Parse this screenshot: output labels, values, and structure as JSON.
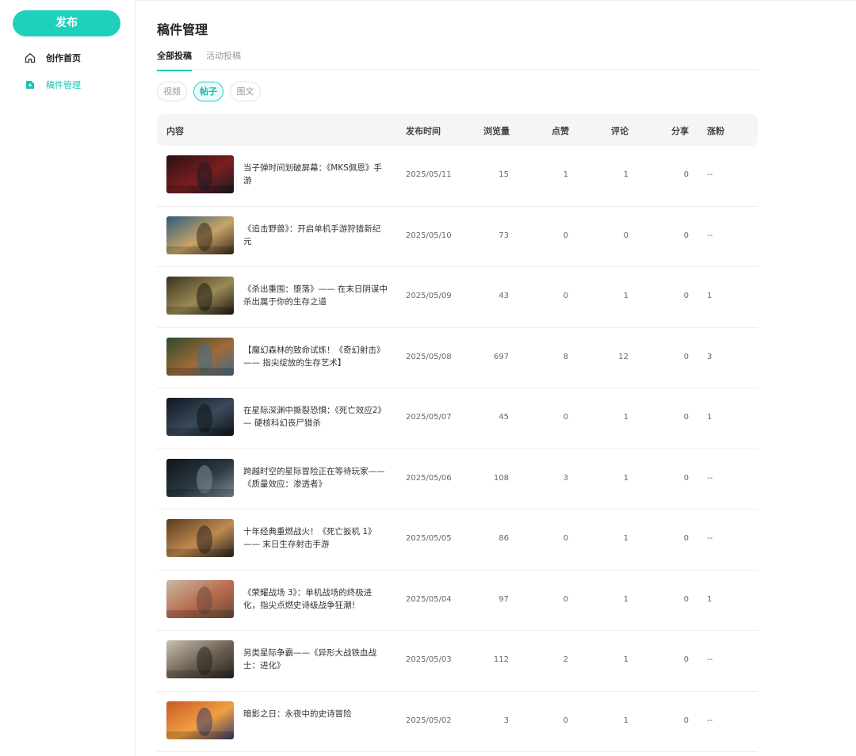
{
  "sidebar": {
    "publish_label": "发布",
    "items": [
      {
        "label": "创作首页",
        "icon": "home-icon"
      },
      {
        "label": "稿件管理",
        "icon": "document-icon",
        "active": true
      }
    ]
  },
  "main": {
    "title": "稿件管理",
    "tabs": [
      {
        "label": "全部投稿",
        "active": true
      },
      {
        "label": "活动投稿",
        "active": false
      }
    ],
    "chips": [
      {
        "label": "视频",
        "active": false
      },
      {
        "label": "帖子",
        "active": true
      },
      {
        "label": "图文",
        "active": false
      }
    ],
    "columns": {
      "content": "内容",
      "date": "发布时间",
      "views": "浏览量",
      "likes": "点赞",
      "comments": "评论",
      "shares": "分享",
      "fans": "涨粉"
    },
    "rows": [
      {
        "title": "当子弹时间划破屏幕：《MKS佩恩》手游",
        "date": "2025/05/11",
        "views": "15",
        "likes": "1",
        "comments": "1",
        "shares": "0",
        "fans": "--"
      },
      {
        "title": "《追击野兽》：开启单机手游狩猎新纪元",
        "date": "2025/05/10",
        "views": "73",
        "likes": "0",
        "comments": "0",
        "shares": "0",
        "fans": "--"
      },
      {
        "title": "《杀出重围：堕落》—— 在末日阴谋中杀出属于你的生存之道",
        "date": "2025/05/09",
        "views": "43",
        "likes": "0",
        "comments": "1",
        "shares": "0",
        "fans": "1"
      },
      {
        "title": "【魔幻森林的致命试炼！《奇幻射击》—— 指尖绽放的生存艺术】",
        "date": "2025/05/08",
        "views": "697",
        "likes": "8",
        "comments": "12",
        "shares": "0",
        "fans": "3"
      },
      {
        "title": "在星际深渊中撕裂恐惧：《死亡效应2》— 硬核科幻丧尸猎杀",
        "date": "2025/05/07",
        "views": "45",
        "likes": "0",
        "comments": "1",
        "shares": "0",
        "fans": "1"
      },
      {
        "title": "跨越时空的星际冒险正在等待玩家——《质量效应：渗透者》",
        "date": "2025/05/06",
        "views": "108",
        "likes": "3",
        "comments": "1",
        "shares": "0",
        "fans": "--"
      },
      {
        "title": "十年经典重燃战火！《死亡扳机 1》—— 末日生存射击手游",
        "date": "2025/05/05",
        "views": "86",
        "likes": "0",
        "comments": "1",
        "shares": "0",
        "fans": "--"
      },
      {
        "title": "《荣耀战场 3》：单机战场的终极进化，指尖点燃史诗级战争狂潮！",
        "date": "2025/05/04",
        "views": "97",
        "likes": "0",
        "comments": "1",
        "shares": "0",
        "fans": "1"
      },
      {
        "title": "另类星际争霸——《异形大战铁血战士：进化》",
        "date": "2025/05/03",
        "views": "112",
        "likes": "2",
        "comments": "1",
        "shares": "0",
        "fans": "--"
      },
      {
        "title": "暗影之日：永夜中的史诗冒险",
        "date": "2025/05/02",
        "views": "3",
        "likes": "0",
        "comments": "1",
        "shares": "0",
        "fans": "--"
      }
    ]
  },
  "colors": {
    "accent": "#1fd1bd",
    "accent_text": "#17c6b2",
    "header_bg": "#f4f5f7"
  }
}
